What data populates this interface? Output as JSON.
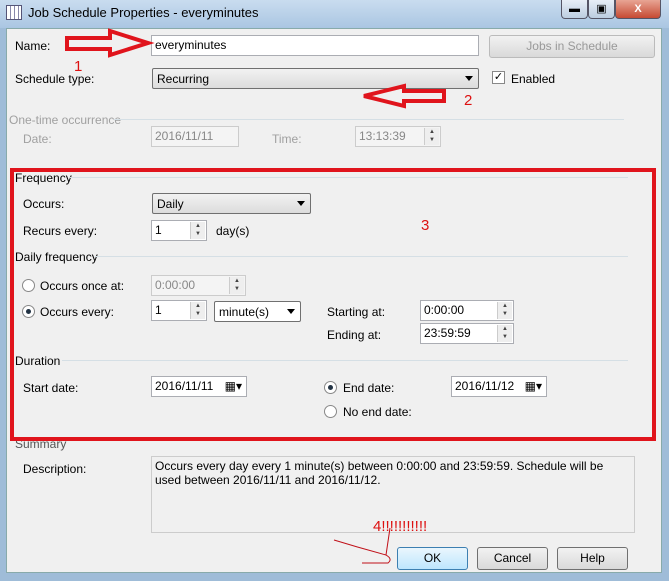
{
  "window": {
    "title": "Job Schedule Properties - everyminutes",
    "minimize": "▬",
    "maximize": "▣",
    "close": "X"
  },
  "general": {
    "name_label": "Name:",
    "name_value": "everyminutes",
    "jobs_button": "Jobs in Schedule",
    "schedule_type_label": "Schedule type:",
    "schedule_type_value": "Recurring",
    "enabled_label": "Enabled",
    "enabled_checked": true
  },
  "one_time": {
    "group": "One-time occurrence",
    "date_label": "Date:",
    "date_value": "2016/11/11",
    "time_label": "Time:",
    "time_value": "13:13:39"
  },
  "frequency": {
    "group": "Frequency",
    "occurs_label": "Occurs:",
    "occurs_value": "Daily",
    "recurs_label": "Recurs every:",
    "recurs_value": "1",
    "recurs_unit": "day(s)"
  },
  "daily": {
    "group": "Daily frequency",
    "once_label": "Occurs once at:",
    "once_value": "0:00:00",
    "every_label": "Occurs every:",
    "every_value": "1",
    "every_unit": "minute(s)",
    "starting_label": "Starting at:",
    "starting_value": "0:00:00",
    "ending_label": "Ending at:",
    "ending_value": "23:59:59",
    "selected": "every"
  },
  "duration": {
    "group": "Duration",
    "start_label": "Start date:",
    "start_value": "2016/11/11",
    "end_label": "End date:",
    "end_value": "2016/11/12",
    "no_end_label": "No end date:",
    "selected": "end"
  },
  "summary": {
    "group": "Summary",
    "desc_label": "Description:",
    "desc_value": "Occurs every day every 1 minute(s) between 0:00:00 and 23:59:59. Schedule will be used between 2016/11/11 and 2016/11/12."
  },
  "buttons": {
    "ok": "OK",
    "cancel": "Cancel",
    "help": "Help"
  },
  "annotations": {
    "a1": "1",
    "a2": "2",
    "a3": "3",
    "a4": "4!!!!!!!!!!!",
    "color": "#e0141c"
  }
}
